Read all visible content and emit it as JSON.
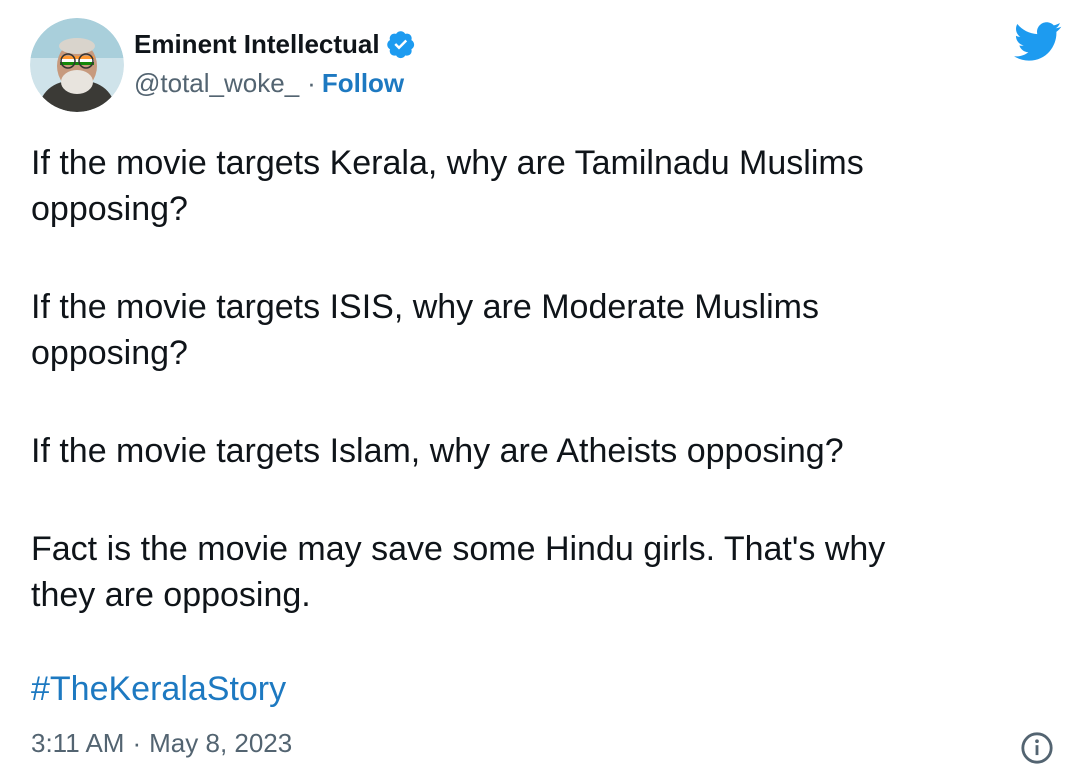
{
  "author": {
    "display_name": "Eminent Intellectual",
    "handle": "@total_woke_",
    "separator": "·",
    "follow_label": "Follow",
    "verified_icon": "verified-badge-icon"
  },
  "tweet": {
    "paragraphs": [
      "If the movie targets Kerala, why are Tamilnadu Muslims\nopposing?",
      "If the movie targets ISIS, why are Moderate Muslims\nopposing?",
      "If the movie targets Islam, why are Atheists opposing?",
      "Fact is the movie may save some Hindu girls. That's why\nthey are opposing."
    ],
    "hashtag": "#TheKeralaStory",
    "time": "3:11 AM",
    "meta_separator": "·",
    "date": "May 8, 2023"
  },
  "colors": {
    "brand_blue": "#1d9bf0",
    "link_blue": "#1d79c1",
    "muted_text": "#536471",
    "text": "#0f1419"
  },
  "icons": [
    "twitter-bird-icon",
    "info-icon",
    "verified-badge-icon"
  ]
}
